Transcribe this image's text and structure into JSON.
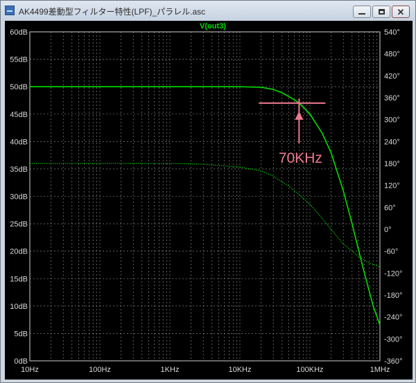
{
  "window": {
    "title": "AK4499差動型フィルター特性(LPF)_パラレル.asc",
    "buttons": {
      "minimize": "minimize",
      "maximize": "maximize",
      "close": "close"
    }
  },
  "plot": {
    "trace_label": "V(out3)",
    "colors": {
      "background": "#000000",
      "trace": "#00e000",
      "grid": "#9a9a9a",
      "annotation": "#f07a90"
    },
    "annotation": {
      "label": "70KHz",
      "frequency_hz": 70000,
      "level_db": 47
    }
  },
  "chart_data": {
    "type": "line",
    "title": "V(out3)",
    "xlabel": "",
    "ylabel": "",
    "x_scale": "log",
    "xlim": [
      10,
      1000000
    ],
    "ylim": [
      0,
      60
    ],
    "y2lim": [
      -360,
      540
    ],
    "x_ticks": [
      "10Hz",
      "100Hz",
      "1KHz",
      "10KHz",
      "100KHz",
      "1MHz"
    ],
    "y_ticks": [
      "0dB",
      "5dB",
      "10dB",
      "15dB",
      "20dB",
      "25dB",
      "30dB",
      "35dB",
      "40dB",
      "45dB",
      "50dB",
      "55dB",
      "60dB"
    ],
    "y2_ticks": [
      "-360°",
      "-300°",
      "-240°",
      "-180°",
      "-120°",
      "-60°",
      "0°",
      "60°",
      "120°",
      "180°",
      "240°",
      "300°",
      "360°",
      "420°",
      "480°",
      "540°"
    ],
    "grid": true,
    "series": [
      {
        "style": "solid",
        "axis": "left",
        "x": [
          10,
          1000,
          10000,
          20000,
          30000,
          40000,
          50000,
          60000,
          70000,
          80000,
          100000,
          150000,
          200000,
          300000,
          400000,
          500000,
          600000,
          800000,
          1000000
        ],
        "y": [
          50,
          50,
          50,
          49.9,
          49.5,
          48.9,
          48.2,
          47.6,
          47,
          46.3,
          45,
          41.5,
          38,
          31,
          25,
          20,
          16,
          10,
          6.5
        ]
      },
      {
        "style": "dotted",
        "axis": "right",
        "x": [
          10,
          1000,
          3000,
          10000,
          20000,
          30000,
          50000,
          70000,
          100000,
          150000,
          200000,
          300000,
          500000,
          700000,
          1000000
        ],
        "y": [
          180,
          180,
          178,
          170,
          160,
          145,
          118,
          95,
          68,
          30,
          0,
          -40,
          -75,
          -92,
          -103
        ]
      }
    ]
  }
}
